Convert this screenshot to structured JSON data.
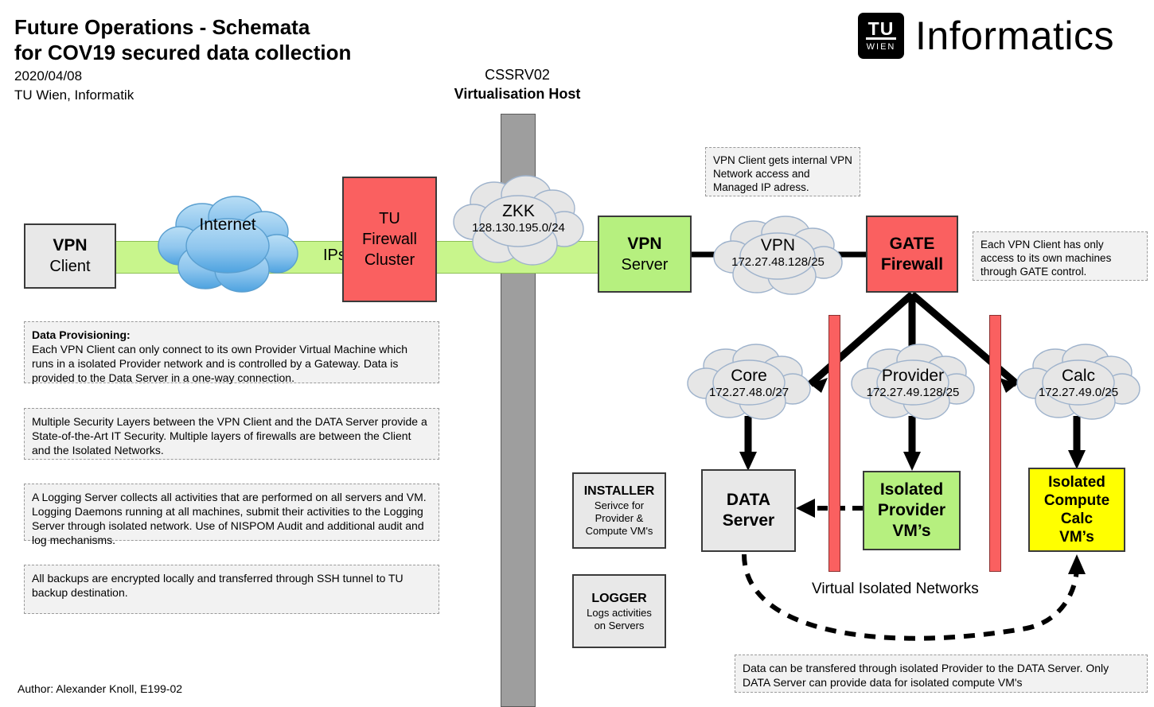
{
  "header": {
    "title_line1": "Future Operations - Schemata",
    "title_line2": "for COV19 secured data collection",
    "date": "2020/04/08",
    "org": "TU Wien, Informatik",
    "logo_tu": "TU",
    "logo_wien": "WIEN",
    "logo_word": "Informatics"
  },
  "host": {
    "name": "CSSRV02",
    "role": "Virtualisation Host"
  },
  "nodes": {
    "vpn_client": {
      "line1": "VPN",
      "line2": "Client"
    },
    "tu_firewall": {
      "line1": "TU",
      "line2": "Firewall",
      "line3": "Cluster"
    },
    "vpn_server": {
      "line1": "VPN",
      "line2": "Server"
    },
    "gate_firewall": {
      "line1": "GATE",
      "line2": "Firewall"
    },
    "data_server": {
      "line1": "DATA",
      "line2": "Server"
    },
    "iso_provider": {
      "line1": "Isolated",
      "line2": "Provider",
      "line3": "VM’s"
    },
    "iso_calc": {
      "line1": "Isolated",
      "line2": "Compute",
      "line3": "Calc",
      "line4": "VM’s"
    },
    "installer": {
      "title": "INSTALLER",
      "sub1": "Serivce for",
      "sub2": "Provider &",
      "sub3": "Compute VM's"
    },
    "logger": {
      "title": "LOGGER",
      "sub1": "Logs activities",
      "sub2": "on Servers"
    }
  },
  "clouds": {
    "internet": {
      "name": "Internet",
      "subnet": ""
    },
    "zkk": {
      "name": "ZKK",
      "subnet": "128.130.195.0/24"
    },
    "vpn": {
      "name": "VPN",
      "subnet": "172.27.48.128/25"
    },
    "core": {
      "name": "Core",
      "subnet": "172.27.48.0/27"
    },
    "provider": {
      "name": "Provider",
      "subnet": "172.27.49.128/25"
    },
    "calc": {
      "name": "Calc",
      "subnet": "172.27.49.0/25"
    }
  },
  "links": {
    "ipsec_tunnel": "IPsec Tunnel",
    "virtual_isolated_networks": "Virtual Isolated Networks"
  },
  "notes": {
    "vpn_client_note": "VPN Client gets internal VPN Network access and Managed IP adress.",
    "gate_note": "Each VPN Client has only access to its own machines through GATE control.",
    "provisioning_title": "Data Provisioning:",
    "provisioning_body": "Each VPN Client can only connect to its own Provider Virtual Machine which runs in a isolated Provider network and is controlled by a Gateway. Data is provided to the Data Server in a one-way connection.",
    "security_note": "Multiple Security Layers between the VPN Client and the DATA Server provide a State-of-the-Art IT Security. Multiple layers of firewalls are between the Client and the Isolated Networks.",
    "logging_note": "A Logging Server collects all activities that are performed on all servers and VM. Logging Daemons running at all machines, submit their activities to the Logging Server through isolated network. Use of NISPOM Audit and additional audit and log mechanisms.",
    "backup_note": "All backups are encrypted locally and transferred through SSH tunnel to TU backup destination.",
    "data_transfer_note": "Data can be transfered through isolated Provider to the DATA Server. Only DATA Server can provide data for isolated compute VM's"
  },
  "footer": {
    "author": "Author: Alexander Knoll, E199-02"
  },
  "colors": {
    "red": "#fa6060",
    "green_box": "#b6f07f",
    "green_tunnel": "#c8f58c",
    "yellow": "#ffff00",
    "grey_box": "#e8e8e8",
    "host_bar": "#9e9e9e",
    "cloud_grey": "#e6e6e6",
    "cloud_blue": "#6db3e8"
  }
}
